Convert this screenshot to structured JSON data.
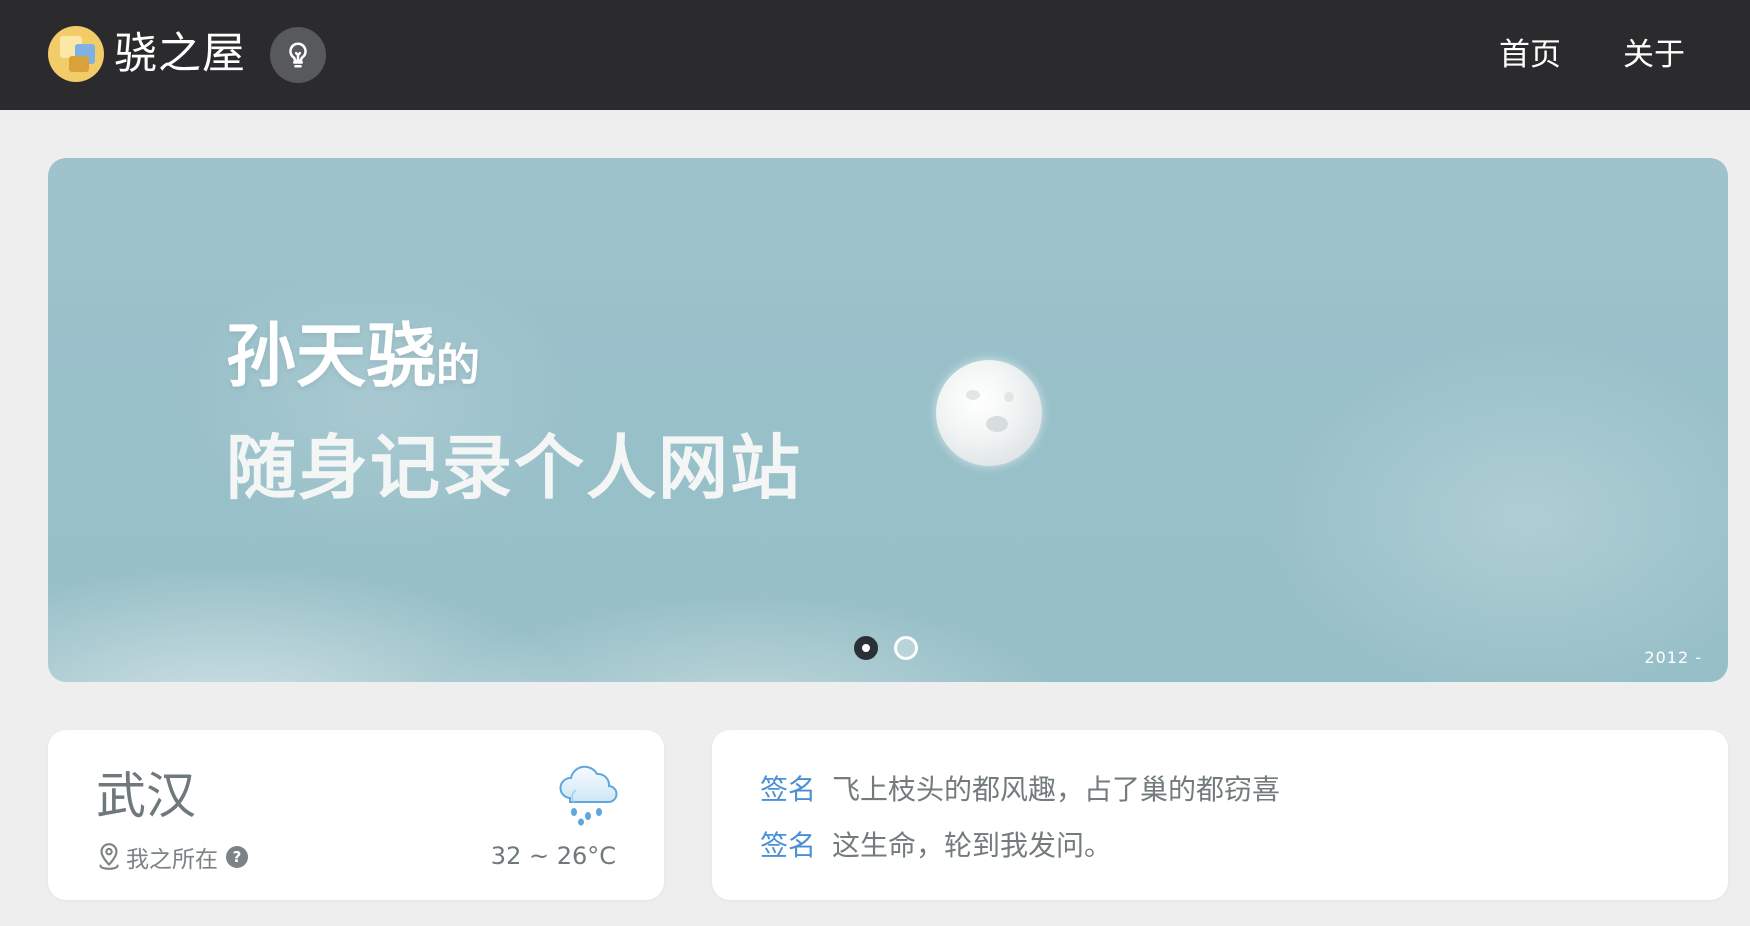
{
  "header": {
    "site_name": "骁之屋",
    "nav": [
      {
        "label": "首页"
      },
      {
        "label": "关于"
      }
    ]
  },
  "banner": {
    "headline_main": "孙天骁",
    "headline_suffix": "的",
    "headline_line2": "随身记录个人网站",
    "year_label": "2012 -",
    "slides": 2,
    "active_slide": 1
  },
  "weather": {
    "city": "武汉",
    "location_label": "我之所在",
    "help_icon": "?",
    "temperature": "32 ~ 26°C",
    "condition_icon": "rain-cloud-icon"
  },
  "signatures": [
    {
      "tag": "签名",
      "text": "飞上枝头的都风趣，占了巢的都窃喜"
    },
    {
      "tag": "签名",
      "text": "这生命，轮到我发问。"
    }
  ],
  "colors": {
    "topbar": "#2b2b2d",
    "page_bg": "#eeeeee",
    "accent_blue": "#4a90d6",
    "banner_sky": "#9fc3cc"
  }
}
